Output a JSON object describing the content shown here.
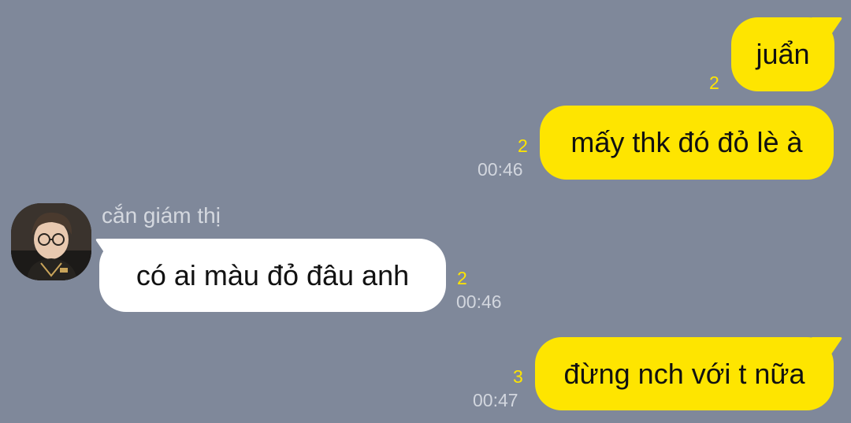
{
  "chat": {
    "messages": [
      {
        "side": "out",
        "text": "juẩn",
        "unread": "2",
        "time": ""
      },
      {
        "side": "out",
        "text": "mấy thk đó đỏ lè à",
        "unread": "2",
        "time": "00:46"
      },
      {
        "side": "in",
        "sender": "cắn giám thị",
        "text": "có ai màu đỏ đâu anh",
        "unread": "2",
        "time": "00:46"
      },
      {
        "side": "out",
        "text": "đừng nch với t nữa",
        "unread": "3",
        "time": "00:47"
      }
    ]
  },
  "colors": {
    "background": "#7f889a",
    "outgoing_bubble": "#fee500",
    "incoming_bubble": "#ffffff",
    "unread_count": "#fee500",
    "timestamp": "#d2d6de"
  },
  "icons": {
    "avatar": "profile-photo"
  }
}
